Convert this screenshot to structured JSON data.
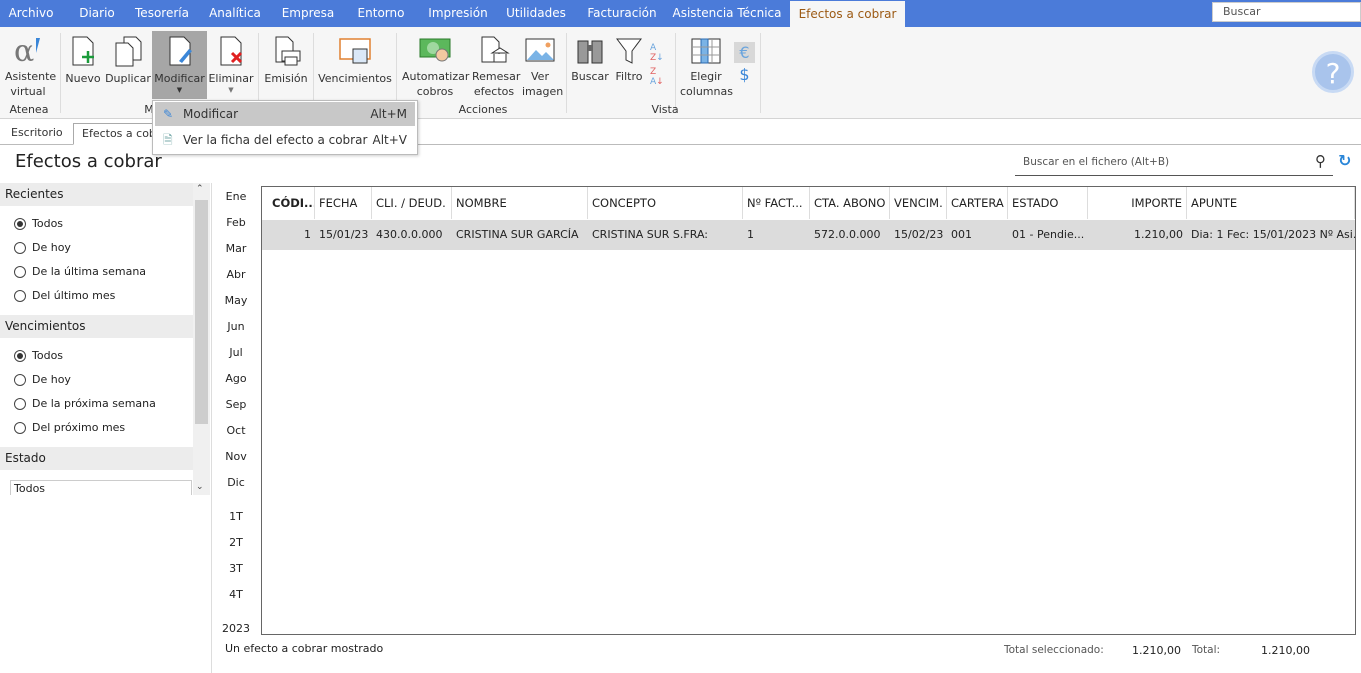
{
  "menu_tabs": [
    "Archivo",
    "Diario",
    "Tesorería",
    "Analítica",
    "Empresa",
    "Entorno",
    "Impresión",
    "Utilidades",
    "Facturación",
    "Asistencia Técnica",
    "Efectos a cobrar"
  ],
  "top_search": {
    "placeholder": "Buscar"
  },
  "ribbon": {
    "buttons": [
      "Asistente virtual",
      "Nuevo",
      "Duplicar",
      "Modificar",
      "Eliminar",
      "Emisión",
      "Vencimientos",
      "Automatizar cobros",
      "Remesar efectos",
      "Ver imagen",
      "Buscar",
      "Filtro",
      "Elegir columnas"
    ],
    "groups": [
      "Atenea",
      "M",
      "Acciones",
      "Vista"
    ]
  },
  "dropdown": {
    "items": [
      {
        "label": "Modificar",
        "shortcut": "Alt+M"
      },
      {
        "label": "Ver la ficha del efecto a cobrar",
        "shortcut": "Alt+V"
      }
    ]
  },
  "doc_tabs": [
    "Escritorio",
    "Efectos a cobr"
  ],
  "page_title": "Efectos a cobrar",
  "file_search": {
    "placeholder": "Buscar en el fichero (Alt+B)"
  },
  "filters": {
    "recientes": {
      "title": "Recientes",
      "options": [
        "Todos",
        "De hoy",
        "De la última semana",
        "Del último mes"
      ],
      "selected": "Todos"
    },
    "vencimientos": {
      "title": "Vencimientos",
      "options": [
        "Todos",
        "De hoy",
        "De la próxima semana",
        "Del próximo mes"
      ],
      "selected": "Todos"
    },
    "estado": {
      "title": "Estado",
      "value": "Todos"
    }
  },
  "months": [
    "Ene",
    "Feb",
    "Mar",
    "Abr",
    "May",
    "Jun",
    "Jul",
    "Ago",
    "Sep",
    "Oct",
    "Nov",
    "Dic"
  ],
  "quarters": [
    "1T",
    "2T",
    "3T",
    "4T"
  ],
  "year": "2023",
  "table": {
    "columns": [
      "CÓDI...",
      "FECHA",
      "CLI. / DEUD.",
      "NOMBRE",
      "CONCEPTO",
      "Nº FACT...",
      "CTA. ABONO",
      "VENCIM.",
      "CARTERA",
      "ESTADO",
      "IMPORTE",
      "APUNTE"
    ],
    "rows": [
      [
        "1",
        "15/01/23",
        "430.0.0.000",
        "CRISTINA SUR GARCÍA",
        "CRISTINA SUR S.FRA:",
        "1",
        "572.0.0.000",
        "15/02/23",
        "001",
        "01 - Pendie...",
        "1.210,00",
        "Dia: 1 Fec: 15/01/2023 Nº Asi..."
      ]
    ]
  },
  "footer": {
    "status": "Un efecto a cobrar mostrado",
    "total_sel_label": "Total seleccionado:",
    "total_sel": "1.210,00",
    "total_label": "Total:",
    "total": "1.210,00"
  },
  "colors": {
    "menubar": "#4b7bd9",
    "active_tab_text": "#9c5a14",
    "selected_row": "#dcdcdc"
  }
}
